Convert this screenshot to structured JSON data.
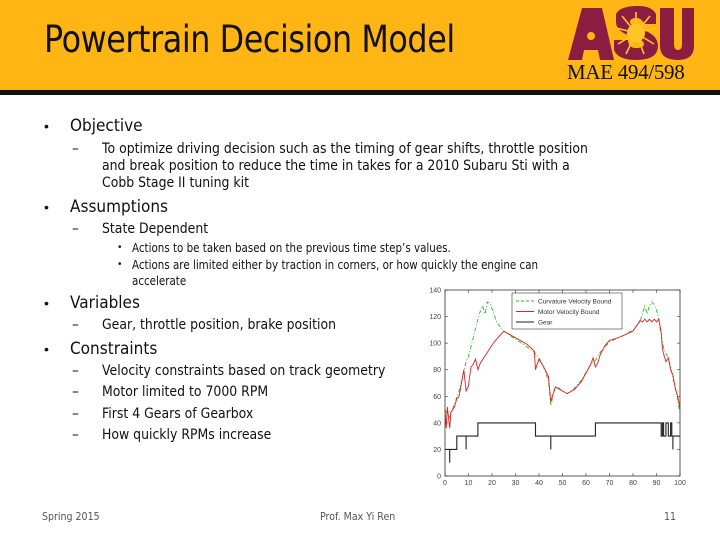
{
  "header": {
    "title": "Powertrain Decision Model",
    "logo_text": "ASU",
    "course_code": "MAE 494/598",
    "colors": {
      "header_bg": "#FFB514",
      "logo_maroon": "#8C1D40",
      "divider": "#111111"
    }
  },
  "body": {
    "sections": [
      {
        "heading": "Objective",
        "items": [
          {
            "lines": [
              "To optimize driving decision such as the timing of gear shifts, throttle position",
              "and break position to reduce the time in takes for a 2010 Subaru Sti with a",
              "Cobb Stage II tuning kit"
            ]
          }
        ]
      },
      {
        "heading": "Assumptions",
        "items": [
          {
            "lines": [
              "State Dependent"
            ],
            "subitems": [
              {
                "lines": [
                  "Actions to be taken based on the previous time step’s values."
                ]
              },
              {
                "lines": [
                  "Actions are limited either by traction in corners, or how quickly the engine can",
                  "accelerate"
                ]
              }
            ]
          }
        ]
      },
      {
        "heading": "Variables",
        "items": [
          {
            "lines": [
              "Gear, throttle position, brake position"
            ]
          }
        ]
      },
      {
        "heading": "Constraints",
        "items": [
          {
            "lines": [
              "Velocity constraints based on track geometry"
            ]
          },
          {
            "lines": [
              "Motor limited to 7000 RPM"
            ]
          },
          {
            "lines": [
              "First 4 Gears of Gearbox"
            ]
          },
          {
            "lines": [
              "How quickly RPMs increase"
            ]
          }
        ]
      }
    ],
    "bullet_glyph": "•",
    "dash_glyph": "–"
  },
  "footer": {
    "left": "Spring 2015",
    "center": "Prof. Max Yi Ren",
    "page_number": "11"
  },
  "chart_data": {
    "type": "line",
    "title": "",
    "xlabel": "",
    "ylabel": "",
    "xlim": [
      0,
      100
    ],
    "ylim": [
      0,
      140
    ],
    "xticks": [
      0,
      10,
      20,
      30,
      40,
      50,
      60,
      70,
      80,
      90,
      100
    ],
    "yticks": [
      0,
      20,
      40,
      60,
      80,
      100,
      120,
      140
    ],
    "grid": false,
    "legend_position": "top-right",
    "series": [
      {
        "name": "Curvature Velocity Bound",
        "color": "#22BB22",
        "style": "dash-dot",
        "points": [
          [
            0,
            50
          ],
          [
            2,
            44
          ],
          [
            4,
            54
          ],
          [
            6,
            64
          ],
          [
            8,
            78
          ],
          [
            9,
            86
          ],
          [
            10,
            90
          ],
          [
            12,
            104
          ],
          [
            14,
            118
          ],
          [
            15,
            124
          ],
          [
            16,
            128
          ],
          [
            17,
            122
          ],
          [
            18,
            131
          ],
          [
            19,
            130
          ],
          [
            20,
            126
          ],
          [
            22,
            116
          ],
          [
            24,
            111
          ],
          [
            25,
            109
          ],
          [
            30,
            103
          ],
          [
            35,
            97
          ],
          [
            38,
            93
          ],
          [
            40,
            89
          ],
          [
            42,
            82
          ],
          [
            44,
            72
          ],
          [
            45,
            53
          ],
          [
            46,
            61
          ],
          [
            47,
            67
          ],
          [
            48,
            67
          ],
          [
            50,
            64
          ],
          [
            52,
            62
          ],
          [
            55,
            66
          ],
          [
            58,
            72
          ],
          [
            62,
            84
          ],
          [
            64,
            87
          ],
          [
            66,
            93
          ],
          [
            68,
            97
          ],
          [
            70,
            101
          ],
          [
            75,
            105
          ],
          [
            80,
            110
          ],
          [
            83,
            116
          ],
          [
            85,
            128
          ],
          [
            86,
            122
          ],
          [
            87,
            128
          ],
          [
            88,
            131
          ],
          [
            89,
            129
          ],
          [
            90,
            125
          ],
          [
            91,
            118
          ],
          [
            92,
            106
          ],
          [
            93,
            96
          ],
          [
            94,
            92
          ],
          [
            95,
            89
          ],
          [
            96,
            82
          ],
          [
            97,
            74
          ],
          [
            98,
            66
          ],
          [
            99,
            58
          ],
          [
            100,
            46
          ]
        ]
      },
      {
        "name": "Motor Velocity Bound",
        "color": "#DD2222",
        "style": "solid",
        "points": [
          [
            0,
            51
          ],
          [
            0.5,
            36
          ],
          [
            1,
            52
          ],
          [
            1.5,
            44
          ],
          [
            2,
            36
          ],
          [
            2.5,
            48
          ],
          [
            4,
            52
          ],
          [
            5,
            58
          ],
          [
            6,
            60
          ],
          [
            7,
            70
          ],
          [
            8,
            80
          ],
          [
            9,
            64
          ],
          [
            10,
            68
          ],
          [
            11,
            82
          ],
          [
            12,
            84
          ],
          [
            13,
            88
          ],
          [
            14,
            80
          ],
          [
            15,
            85
          ],
          [
            18,
            93
          ],
          [
            21,
            101
          ],
          [
            25,
            109
          ],
          [
            30,
            104
          ],
          [
            35,
            99
          ],
          [
            38,
            94
          ],
          [
            38.5,
            80
          ],
          [
            39,
            83
          ],
          [
            40,
            88
          ],
          [
            42,
            82
          ],
          [
            44,
            75
          ],
          [
            45,
            56
          ],
          [
            46,
            62
          ],
          [
            47,
            67
          ],
          [
            48,
            66
          ],
          [
            50,
            64
          ],
          [
            52,
            62
          ],
          [
            55,
            65
          ],
          [
            58,
            71
          ],
          [
            62,
            84
          ],
          [
            63,
            89
          ],
          [
            64,
            82
          ],
          [
            65,
            85
          ],
          [
            66,
            91
          ],
          [
            68,
            98
          ],
          [
            70,
            102
          ],
          [
            75,
            105
          ],
          [
            80,
            109
          ],
          [
            83,
            117
          ],
          [
            84,
            116
          ],
          [
            85,
            118
          ],
          [
            86,
            116
          ],
          [
            87,
            118
          ],
          [
            88,
            116
          ],
          [
            89,
            118
          ],
          [
            90,
            116
          ],
          [
            91,
            118
          ],
          [
            92,
            108
          ],
          [
            92.5,
            96
          ],
          [
            93,
            92
          ],
          [
            94,
            86
          ],
          [
            95,
            89
          ],
          [
            96,
            80
          ],
          [
            97,
            76
          ],
          [
            98,
            66
          ],
          [
            99,
            60
          ],
          [
            99.5,
            56
          ],
          [
            100,
            50
          ]
        ]
      },
      {
        "name": "Gear",
        "color": "#222222",
        "style": "solid",
        "scale_note": "gear number x 10",
        "points": [
          [
            0,
            20
          ],
          [
            2,
            20
          ],
          [
            2,
            10
          ],
          [
            2,
            20
          ],
          [
            5,
            20
          ],
          [
            5,
            30
          ],
          [
            9,
            30
          ],
          [
            9,
            20
          ],
          [
            9,
            30
          ],
          [
            14,
            30
          ],
          [
            14,
            40
          ],
          [
            38.5,
            40
          ],
          [
            38.5,
            30
          ],
          [
            45,
            30
          ],
          [
            45,
            20
          ],
          [
            45,
            30
          ],
          [
            64,
            30
          ],
          [
            64,
            40
          ],
          [
            92,
            40
          ],
          [
            92,
            30
          ],
          [
            92.5,
            30
          ],
          [
            92.5,
            40
          ],
          [
            93,
            40
          ],
          [
            93,
            30
          ],
          [
            94,
            30
          ],
          [
            94,
            40
          ],
          [
            95,
            40
          ],
          [
            95,
            30
          ],
          [
            96,
            30
          ],
          [
            96,
            40
          ],
          [
            96.5,
            40
          ],
          [
            96.5,
            30
          ],
          [
            97,
            30
          ],
          [
            97,
            20
          ],
          [
            97,
            30
          ],
          [
            100,
            30
          ]
        ]
      }
    ]
  }
}
